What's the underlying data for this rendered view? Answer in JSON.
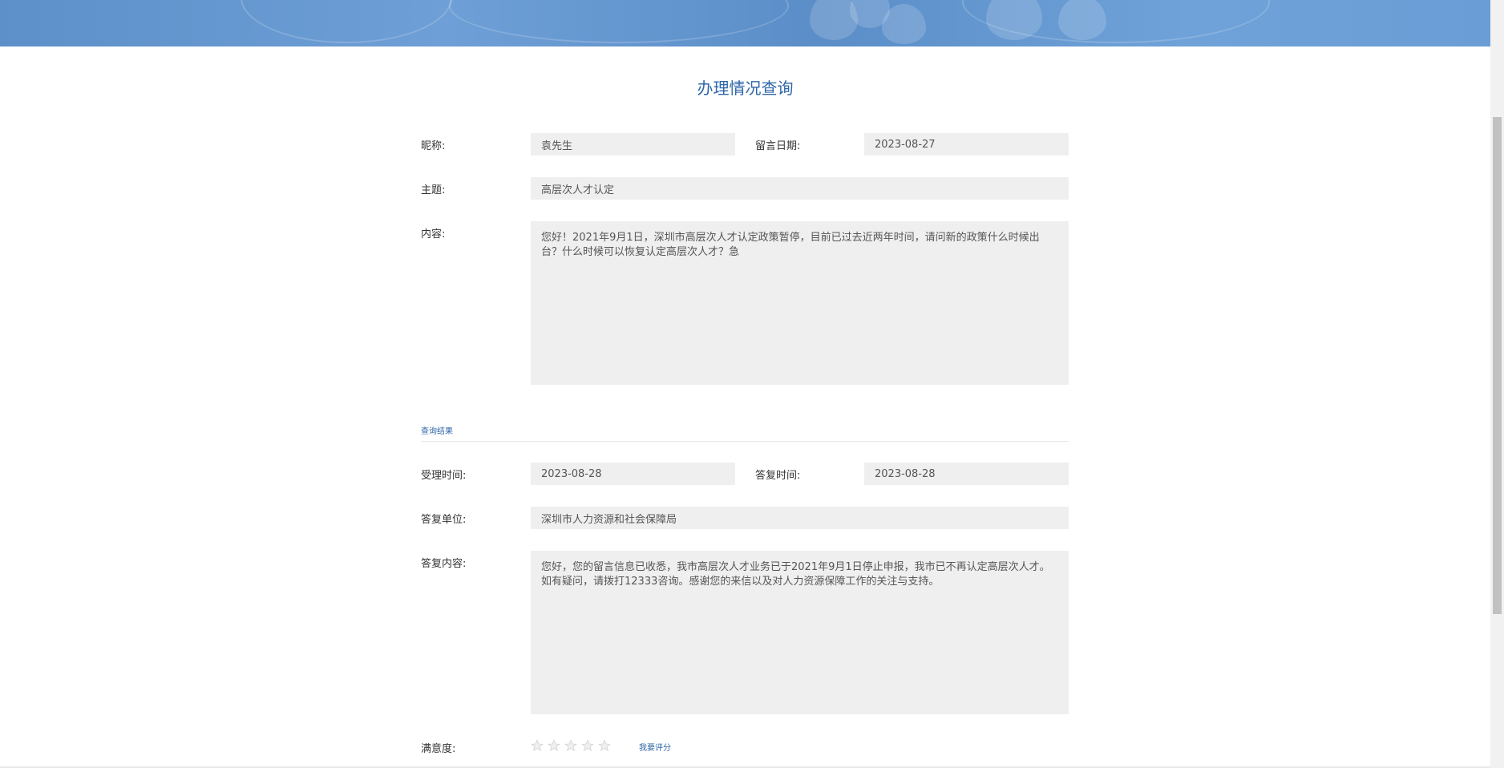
{
  "page": {
    "title": "办理情况查询"
  },
  "inquiry": {
    "nickname_label": "昵称:",
    "nickname_value": "袁先生",
    "date_label": "留言日期:",
    "date_value": "2023-08-27",
    "subject_label": "主题:",
    "subject_value": "高层次人才认定",
    "content_label": "内容:",
    "content_value": "您好！2021年9月1日，深圳市高层次人才认定政策暂停，目前已过去近两年时间，请问新的政策什么时候出台？什么时候可以恢复认定高层次人才？急"
  },
  "result": {
    "section_label": "查询结果",
    "accept_time_label": "受理时间:",
    "accept_time_value": "2023-08-28",
    "reply_time_label": "答复时间:",
    "reply_time_value": "2023-08-28",
    "reply_unit_label": "答复单位:",
    "reply_unit_value": "深圳市人力资源和社会保障局",
    "reply_content_label": "答复内容:",
    "reply_content_value": "您好，您的留言信息已收悉，我市高层次人才业务已于2021年9月1日停止申报，我市已不再认定高层次人才。如有疑问，请拨打12333咨询。感谢您的来信以及对人力资源保障工作的关注与支持。"
  },
  "satisfaction": {
    "label": "满意度:",
    "stars_total": 5,
    "stars_filled": 0,
    "star_icon": "star-outline-icon",
    "rate_link": "我要评分"
  },
  "colors": {
    "accent": "#2e66a8",
    "field_bg": "#efefef",
    "banner": "#6a9dd5"
  }
}
